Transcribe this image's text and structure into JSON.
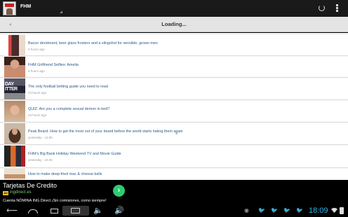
{
  "app": {
    "title": "FHM",
    "icon": "fhm-app-icon"
  },
  "actionbar": {
    "refresh_icon": "refresh-icon",
    "overflow_icon": "overflow-menu-icon"
  },
  "loading": {
    "text": "Loading..."
  },
  "articles": [
    {
      "title": "Bacon deodorant, beer glass frosters and a slingshot for sensible, grown men",
      "time": "6 hours ago"
    },
    {
      "title": "FHM Girlfriend Selfies: Amelia",
      "time": "6 hours ago"
    },
    {
      "title": "The only football betting guide you need to read",
      "time": "23 hours ago",
      "thumb_text": "DAY ITTER"
    },
    {
      "title": "QUIZ: Are you a complete sexual demon in bed?",
      "time": "23 hours ago"
    },
    {
      "title": "Peak Beard: How to get the most out of your beard before the world starts hating them again",
      "time": "yesterday - 14:50"
    },
    {
      "title": "FHM's Big Bank Holiday Weekend TV and Movie Guide",
      "time": "yesterday - 10:35"
    },
    {
      "title": "How to make deep-fried mac & cheese balls",
      "time": ""
    }
  ],
  "ad": {
    "title": "Tarjetas De Credito",
    "badge": "Ad",
    "domain": "ingdirect.es",
    "description": "Cuenta NÓMINA ING Direct ¡Sin comisiones, como siempre!",
    "go_label": "›",
    "accent": "#2ecc71"
  },
  "statusbar": {
    "clock": "18:09",
    "clock_color": "#33b5e5"
  }
}
